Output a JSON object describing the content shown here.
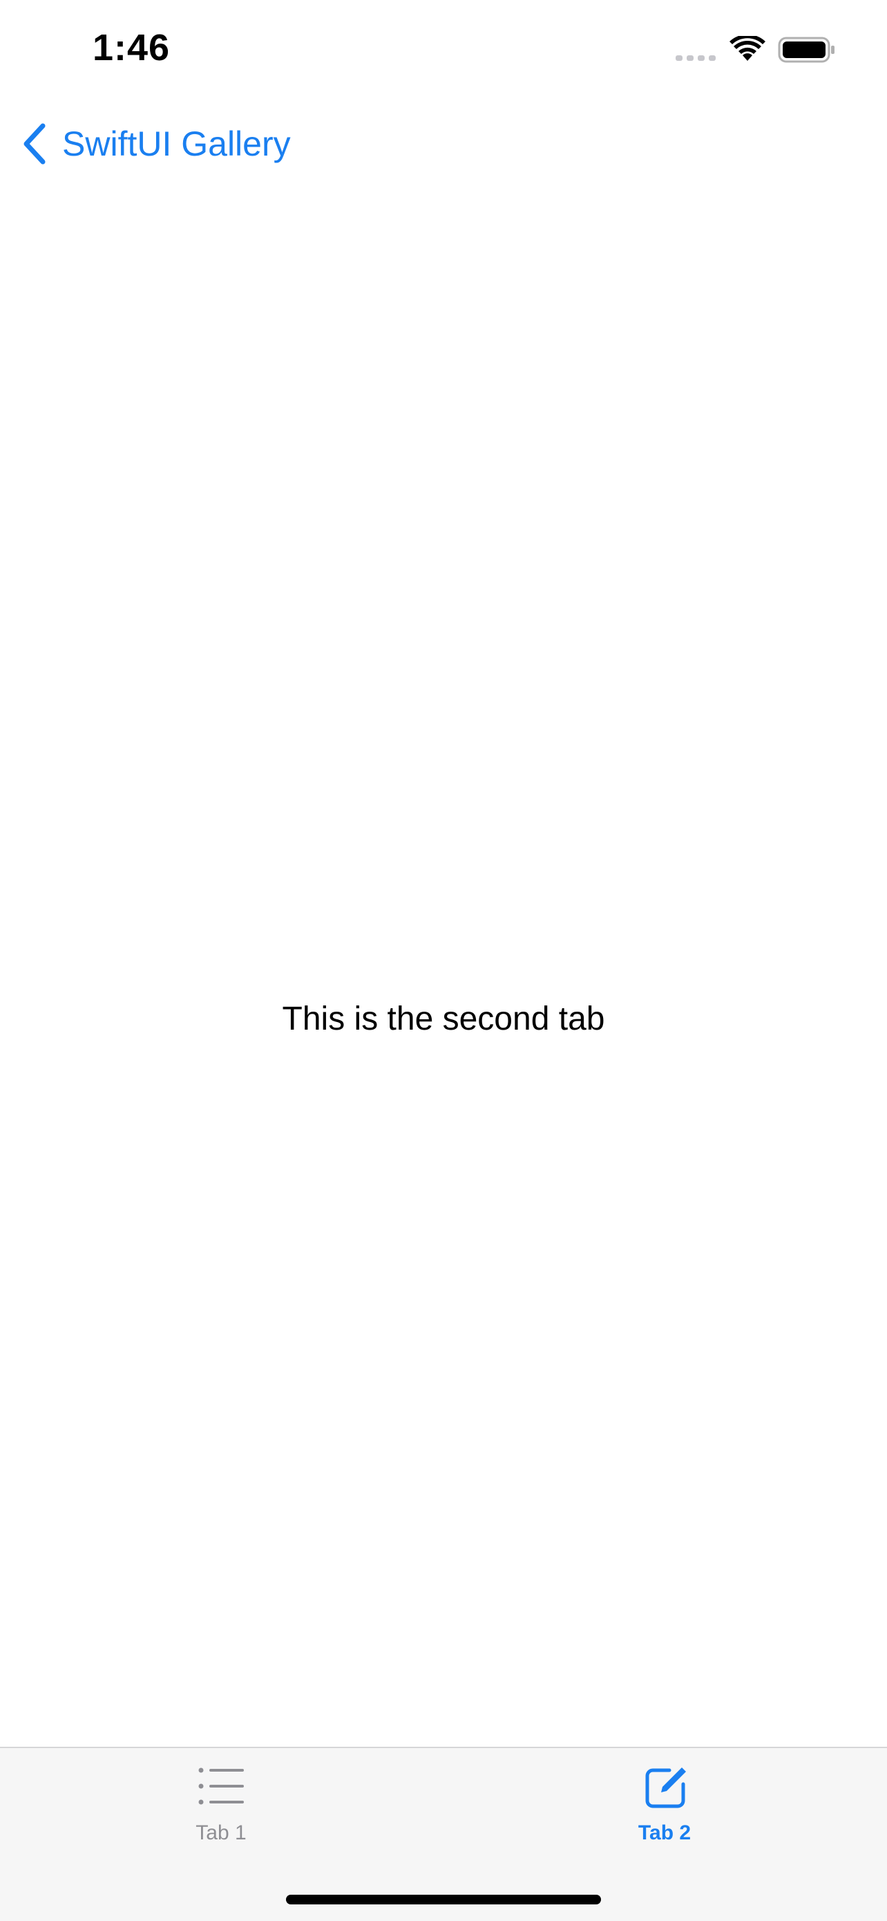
{
  "status_bar": {
    "time": "1:46"
  },
  "nav": {
    "back_label": "SwiftUI Gallery",
    "back_icon": "chevron-left-icon"
  },
  "main": {
    "text": "This is the second tab"
  },
  "tabs": [
    {
      "label": "Tab 1",
      "icon": "list-icon",
      "selected": false
    },
    {
      "label": "Tab 2",
      "icon": "square-pencil-icon",
      "selected": true
    }
  ],
  "colors": {
    "accent": "#1a7ff0",
    "inactive": "#8e8e93",
    "tab_bar_bg": "#f6f6f6"
  }
}
